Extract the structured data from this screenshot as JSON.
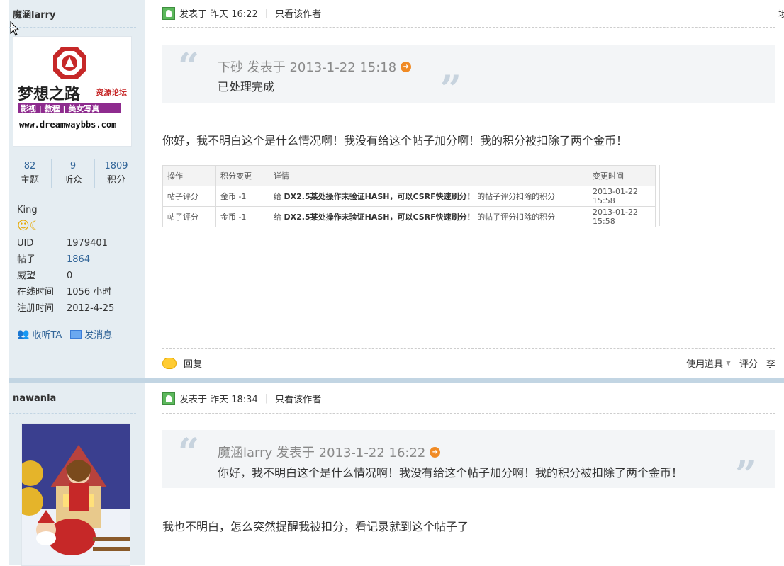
{
  "posts": [
    {
      "username": "魔涵larry",
      "avatar_text": {
        "line1": "梦想之路",
        "line2": "资源论坛",
        "line3": "影视 | 教程 | 美女写真",
        "line4": "www.dreamwaybbs.com"
      },
      "stats": [
        {
          "num": "82",
          "label": "主题"
        },
        {
          "num": "9",
          "label": "听众"
        },
        {
          "num": "1809",
          "label": "积分"
        }
      ],
      "rank": "King",
      "rank_icons": "☺☾",
      "info": [
        {
          "key": "UID",
          "value": "1979401"
        },
        {
          "key": "帖子",
          "value": "1864"
        },
        {
          "key": "威望",
          "value": "0"
        },
        {
          "key": "在线时间",
          "value": "1056 小时"
        },
        {
          "key": "注册时间",
          "value": "2012-4-25"
        }
      ],
      "follow_label": "收听TA",
      "message_label": "发消息",
      "posted": "发表于 昨天 16:22",
      "only_author": "只看该作者",
      "quote_author": "下砂 发表于 2013-1-22 15:18",
      "quote_text": "已处理完成",
      "message": "你好，我不明白这个是什么情况啊！我没有给这个帖子加分啊！我的积分被扣除了两个金币！",
      "log_headers": [
        "操作",
        "积分变更",
        "详情",
        "变更时间"
      ],
      "log_rows": [
        {
          "op": "帖子评分",
          "change": "金币 -1",
          "d1": "给",
          "d2": "DX2.5某处操作未验证HASH，可以CSRF快速刷分！",
          "d3": "的帖子评分扣除的积分",
          "time": "2013-01-22 15:58"
        },
        {
          "op": "帖子评分",
          "change": "金币 -1",
          "d1": "给",
          "d2": "DX2.5某处操作未验证HASH，可以CSRF快速刷分！",
          "d3": "的帖子评分扣除的积分",
          "time": "2013-01-22 15:58"
        }
      ],
      "reply_label": "回复",
      "tools_label": "使用道具",
      "rate_label": "评分",
      "topright_char": "埗",
      "rate_tail": "李"
    },
    {
      "username": "nawanla",
      "posted": "发表于 昨天 18:34",
      "only_author": "只看该作者",
      "quote_author": "魔涵larry 发表于 2013-1-22 16:22",
      "quote_text": "你好，我不明白这个是什么情况啊！我没有给这个帖子加分啊！我的积分被扣除了两个金币！",
      "message": "我也不明白，怎么突然提醒我被扣分，看记录就到这个帖子了"
    }
  ],
  "colors": {
    "sidebar": "#e5edf2",
    "link": "#336699",
    "quote_bg": "#f3f5f7",
    "accent_orange": "#f08a24"
  }
}
